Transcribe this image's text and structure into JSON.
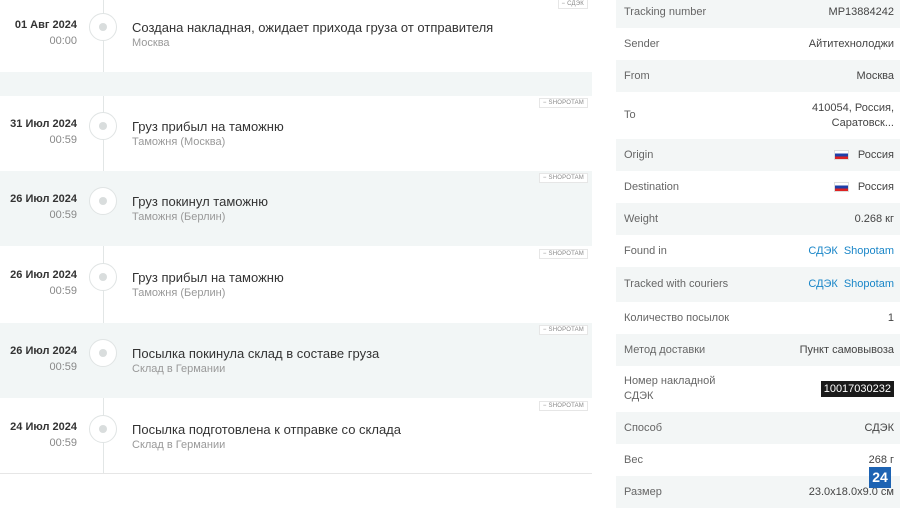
{
  "events": [
    {
      "date": "01 Авг 2024",
      "time": "00:00",
      "title": "Создана накладная, ожидает прихода груза от отправителя",
      "location": "Москва",
      "badge": "СДЭК"
    },
    {
      "date": "31 Июл 2024",
      "time": "00:59",
      "title": "Груз прибыл на таможню",
      "location": "Таможня (Москва)",
      "badge": "SHOPOTAM"
    },
    {
      "date": "26 Июл 2024",
      "time": "00:59",
      "title": "Груз покинул таможню",
      "location": "Таможня (Берлин)",
      "badge": "SHOPOTAM"
    },
    {
      "date": "26 Июл 2024",
      "time": "00:59",
      "title": "Груз прибыл на таможню",
      "location": "Таможня (Берлин)",
      "badge": "SHOPOTAM"
    },
    {
      "date": "26 Июл 2024",
      "time": "00:59",
      "title": "Посылка покинула склад в составе груза",
      "location": "Склад в Германии",
      "badge": "SHOPOTAM"
    },
    {
      "date": "24 Июл 2024",
      "time": "00:59",
      "title": "Посылка подготовлена к отправке со склада",
      "location": "Склад в Германии",
      "badge": "SHOPOTAM"
    }
  ],
  "info": {
    "tracking_number": {
      "label": "Tracking number",
      "value": "MP13884242"
    },
    "sender": {
      "label": "Sender",
      "value": "Айтитехнолоджи"
    },
    "from": {
      "label": "From",
      "value": "Москва"
    },
    "to": {
      "label": "To",
      "value_line1": "410054, Россия,",
      "value_line2": "Саратовск..."
    },
    "origin": {
      "label": "Origin",
      "value": "Россия",
      "flag": "russia-flag-icon"
    },
    "destination": {
      "label": "Destination",
      "value": "Россия",
      "flag": "russia-flag-icon"
    },
    "weight": {
      "label": "Weight",
      "value": "0.268 кг"
    },
    "found_in": {
      "label": "Found in",
      "link1": "СДЭК",
      "link2": "Shopotam"
    },
    "tracked_with": {
      "label": "Tracked with couriers",
      "link1": "СДЭК",
      "link2": "Shopotam"
    },
    "count": {
      "label": "Количество посылок",
      "value": "1"
    },
    "delivery_method": {
      "label": "Метод доставки",
      "value": "Пункт самовывоза"
    },
    "waybill": {
      "label_line1": "Номер накладной",
      "label_line2": "СДЭК",
      "value": "10017030232"
    },
    "method": {
      "label": "Способ",
      "value": "СДЭК"
    },
    "weight2": {
      "label": "Вес",
      "value": "268 г"
    },
    "size": {
      "label": "Размер",
      "value": "23.0x18.0x9.0 см"
    }
  },
  "watermark": "24",
  "colors": {
    "link": "#1a86c8",
    "alt_row": "#f3f6f6",
    "highlight_bg": "#1a1a1a"
  }
}
